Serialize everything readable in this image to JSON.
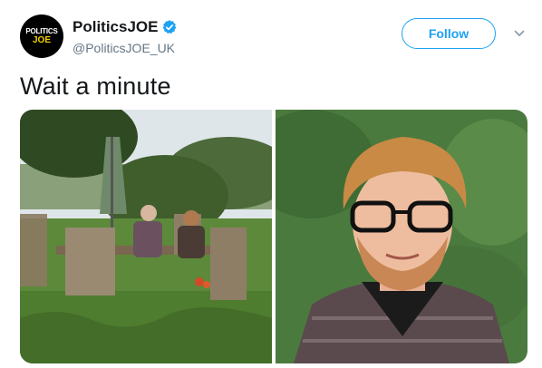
{
  "tweet": {
    "author": {
      "display_name": "PoliticsJOE",
      "handle": "@PoliticsJOE_UK",
      "avatar_line1": "POLITICS",
      "avatar_line2": "JOE",
      "verified": true
    },
    "follow_label": "Follow",
    "text": "Wait a minute",
    "icons": {
      "verified": "verified-badge-icon",
      "menu": "chevron-down-icon"
    },
    "colors": {
      "accent": "#1da1f2",
      "handle": "#657786",
      "text": "#14171a",
      "avatar_bg": "#000000",
      "avatar_accent": "#f5d400"
    }
  }
}
